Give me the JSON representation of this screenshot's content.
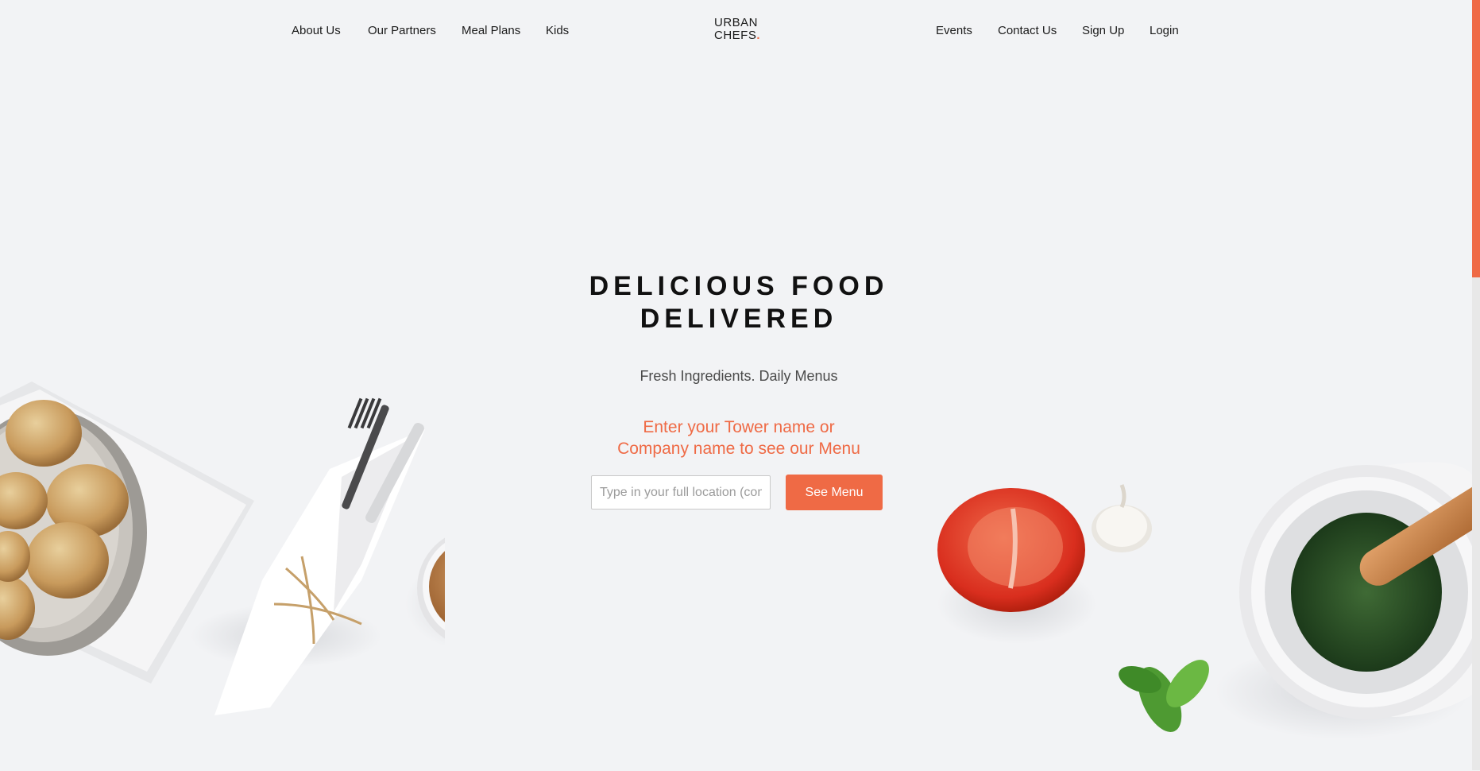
{
  "nav": {
    "left": [
      "About Us",
      "Our Partners",
      "Meal Plans",
      "Kids"
    ],
    "right": [
      "Events",
      "Contact Us",
      "Sign Up",
      "Login"
    ]
  },
  "logo": {
    "line1": "URBAN",
    "line2": "CHEFS",
    "dot": "."
  },
  "hero": {
    "title_line1": "DELICIOUS FOOD",
    "title_line2": "DELIVERED",
    "subtitle": "Fresh Ingredients. Daily Menus",
    "prompt_line1": "Enter your Tower name or",
    "prompt_line2": "Company name to see our Menu"
  },
  "search": {
    "placeholder": "Type in your full location (company, tower)",
    "value": "",
    "button_label": "See Menu"
  },
  "scrollbar": {
    "position_fraction": 0.36
  },
  "colors": {
    "accent": "#ef6a45",
    "background": "#f2f3f5",
    "text": "#111111"
  },
  "images": {
    "left": [
      "bread-bowl-image",
      "napkin-image",
      "fork-knife-image",
      "honey-jar-image"
    ],
    "right": [
      "tomato-image",
      "garlic-image",
      "basil-image",
      "mortar-pestle-image"
    ]
  }
}
